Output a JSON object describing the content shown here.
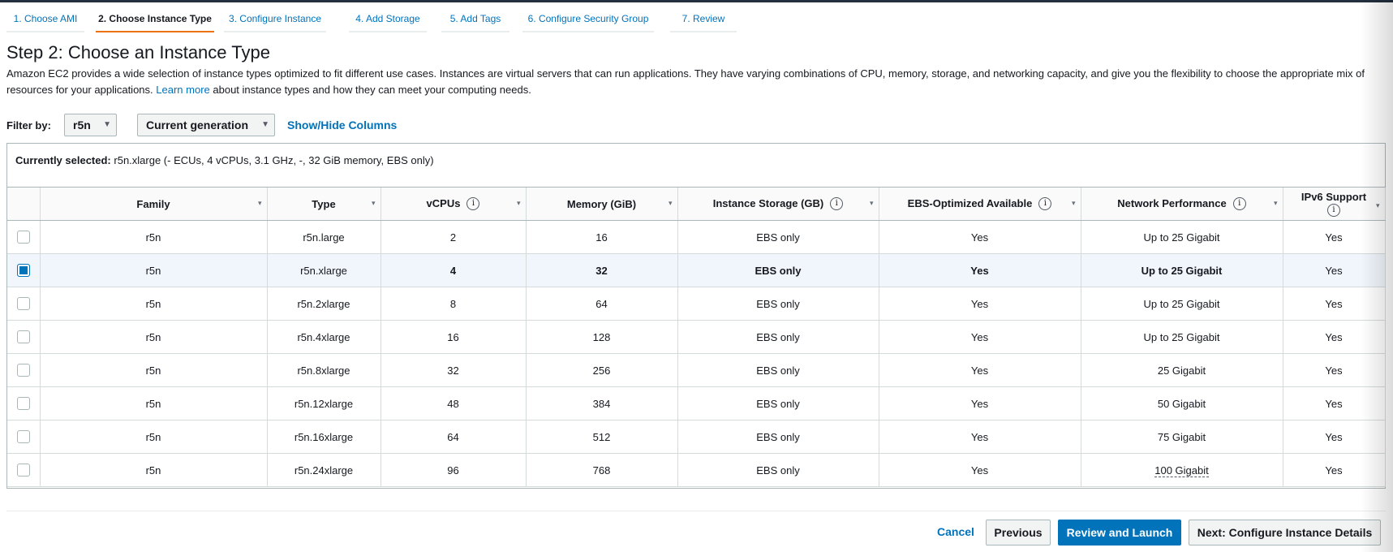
{
  "wizard": {
    "tabs": [
      {
        "label": "1. Choose AMI"
      },
      {
        "label": "2. Choose Instance Type"
      },
      {
        "label": "3. Configure Instance"
      },
      {
        "label": "4. Add Storage"
      },
      {
        "label": "5. Add Tags"
      },
      {
        "label": "6. Configure Security Group"
      },
      {
        "label": "7. Review"
      }
    ],
    "active_tab": "2. Choose Instance Type"
  },
  "page": {
    "title": "Step 2: Choose an Instance Type",
    "description_prefix": "Amazon EC2 provides a wide selection of instance types optimized to fit different use cases. Instances are virtual servers that can run applications. They have varying combinations of CPU, memory, storage, and networking capacity, and give you the flexibility to choose the appropriate mix of resources for your applications.",
    "learn_more": "Learn more",
    "description_suffix": "about instance types and how they can meet your computing needs."
  },
  "filter": {
    "label": "Filter by:",
    "family_value": "r5n",
    "generation_value": "Current generation",
    "show_hide": "Show/Hide Columns"
  },
  "selection": {
    "label": "Currently selected:",
    "value": "r5n.xlarge (- ECUs, 4 vCPUs, 3.1 GHz, -, 32 GiB memory, EBS only)"
  },
  "table": {
    "headers": {
      "family": "Family",
      "type": "Type",
      "vcpus": "vCPUs",
      "memory": "Memory (GiB)",
      "storage": "Instance Storage (GB)",
      "ebs": "EBS-Optimized Available",
      "network": "Network Performance",
      "ipv6": "IPv6 Support"
    },
    "rows": [
      {
        "family": "r5n",
        "type": "r5n.large",
        "vcpus": "2",
        "memory": "16",
        "storage": "EBS only",
        "ebs": "Yes",
        "network": "Up to 25 Gigabit",
        "ipv6": "Yes"
      },
      {
        "family": "r5n",
        "type": "r5n.xlarge",
        "vcpus": "4",
        "memory": "32",
        "storage": "EBS only",
        "ebs": "Yes",
        "network": "Up to 25 Gigabit",
        "ipv6": "Yes"
      },
      {
        "family": "r5n",
        "type": "r5n.2xlarge",
        "vcpus": "8",
        "memory": "64",
        "storage": "EBS only",
        "ebs": "Yes",
        "network": "Up to 25 Gigabit",
        "ipv6": "Yes"
      },
      {
        "family": "r5n",
        "type": "r5n.4xlarge",
        "vcpus": "16",
        "memory": "128",
        "storage": "EBS only",
        "ebs": "Yes",
        "network": "Up to 25 Gigabit",
        "ipv6": "Yes"
      },
      {
        "family": "r5n",
        "type": "r5n.8xlarge",
        "vcpus": "32",
        "memory": "256",
        "storage": "EBS only",
        "ebs": "Yes",
        "network": "25 Gigabit",
        "ipv6": "Yes"
      },
      {
        "family": "r5n",
        "type": "r5n.12xlarge",
        "vcpus": "48",
        "memory": "384",
        "storage": "EBS only",
        "ebs": "Yes",
        "network": "50 Gigabit",
        "ipv6": "Yes"
      },
      {
        "family": "r5n",
        "type": "r5n.16xlarge",
        "vcpus": "64",
        "memory": "512",
        "storage": "EBS only",
        "ebs": "Yes",
        "network": "75 Gigabit",
        "ipv6": "Yes"
      },
      {
        "family": "r5n",
        "type": "r5n.24xlarge",
        "vcpus": "96",
        "memory": "768",
        "storage": "EBS only",
        "ebs": "Yes",
        "network": "100 Gigabit",
        "ipv6": "Yes"
      }
    ],
    "selected_row": 1,
    "info_icon_glyph": "i",
    "sort_icon_glyph": "▾"
  },
  "footer": {
    "cancel": "Cancel",
    "previous": "Previous",
    "review_launch": "Review and Launch",
    "next": "Next: Configure Instance Details"
  },
  "colors": {
    "accent": "#0073bb",
    "active_tab_underline": "#ec7211",
    "selected_row_bg": "#f1f6fc"
  }
}
